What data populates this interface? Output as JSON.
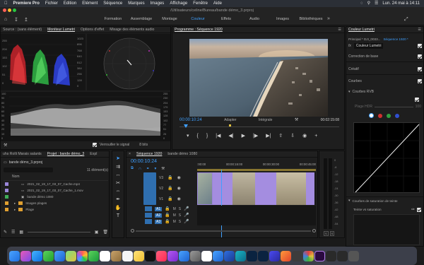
{
  "menubar": {
    "app": "Premiere Pro",
    "items": [
      "Fichier",
      "Edition",
      "Elément",
      "Séquence",
      "Marques",
      "Images",
      "Affichage",
      "Fenêtre",
      "Aide"
    ],
    "clock": "Lun. 24 mai à 14:11"
  },
  "titlebar": {
    "path": "/Utilisateurs/celine/Bureau/bande démo_3.prproj"
  },
  "workspaces": {
    "tabs": [
      "Formation",
      "Assemblage",
      "Montage",
      "Couleur",
      "Effets",
      "Audio",
      "Images",
      "Bibliothèques"
    ],
    "active": "Couleur"
  },
  "source_panel": {
    "tabs": [
      "Source : (sans élément)",
      "Moniteur Lumetri",
      "Options d'effet",
      "Mixage des éléments audio"
    ],
    "active_tab": "Moniteur Lumetri",
    "parade_scale": [
      "255",
      "204",
      "153",
      "102",
      "51",
      "0"
    ],
    "parade_scale_right": [
      "1023",
      "896",
      "768",
      "640",
      "512",
      "384",
      "256",
      "128",
      "0"
    ],
    "wave_scale": [
      "100",
      "90",
      "80",
      "70",
      "60",
      "50",
      "40",
      "30",
      "20",
      "10",
      "0"
    ],
    "wave_scale_right": [
      "255",
      "230",
      "204",
      "179",
      "153",
      "128",
      "102",
      "77",
      "51",
      "26",
      "0"
    ],
    "clamp_label": "Verrouiller le signal",
    "bits_label": "8 bits"
  },
  "program_panel": {
    "title": "Programme : Séquence 1920",
    "timecode": "00:00:10:24",
    "fit": "Adapter",
    "quality": "Intégrale",
    "duration": "00:02:15:08"
  },
  "lumetri_panel": {
    "title": "Couleur Lumetri",
    "source_label": "Principal * DJI_0033...",
    "sequence_label": "Séquence 1920 *",
    "fx_label": "Couleur Lumetri",
    "sections": [
      "Correction de base",
      "Créatif",
      "Courbes"
    ],
    "rgb_curves": "Courbes RVB",
    "hdr_range_label": "Plage HDR",
    "hdr_range_value": "100",
    "saturation_curves": "Courbes de saturation de teinte",
    "hue_vs_sat": "Teinte vs saturation"
  },
  "project_panel": {
    "tabs": [
      "uhs Rolli Marais salants",
      "Projet : bande démo_3",
      "Expl"
    ],
    "file": "bande démo_3.prproj",
    "count": "11 élément(s)",
    "col_name": "Nom",
    "items": [
      {
        "name": "2021_02_19_17_03_07_Cache.mp4",
        "color": "#9a86d8"
      },
      {
        "name": "2021_02_19_17_03_07_Cache_1.mov",
        "color": "#9a86d8"
      },
      {
        "name": "bande démo 1080",
        "color": "#3fae58"
      },
      {
        "name": "Images plages",
        "color": "#e0a030"
      },
      {
        "name": "Plage",
        "color": "#e0a030"
      }
    ]
  },
  "timeline_panel": {
    "tabs": [
      "Séquence 1920",
      "bande démo 1080"
    ],
    "timecode": "00:00:10:24",
    "ruler": [
      ":00:00",
      "00:00:15:00",
      "00:00:30:00",
      "00:00:45:00"
    ],
    "video_tracks": [
      "V3",
      "V2",
      "V1"
    ],
    "audio_tracks": [
      "A1",
      "A2",
      "A3"
    ],
    "track_flags": [
      "M",
      "S"
    ]
  },
  "meter_scale": [
    "0",
    "-6",
    "-12",
    "-18",
    "-24",
    "-30",
    "-36",
    "-42",
    "-48",
    "-54"
  ],
  "colors": {
    "accent": "#3fa0ff",
    "clip_violet": "#a48de0",
    "track_blue": "#2f6fb0"
  }
}
